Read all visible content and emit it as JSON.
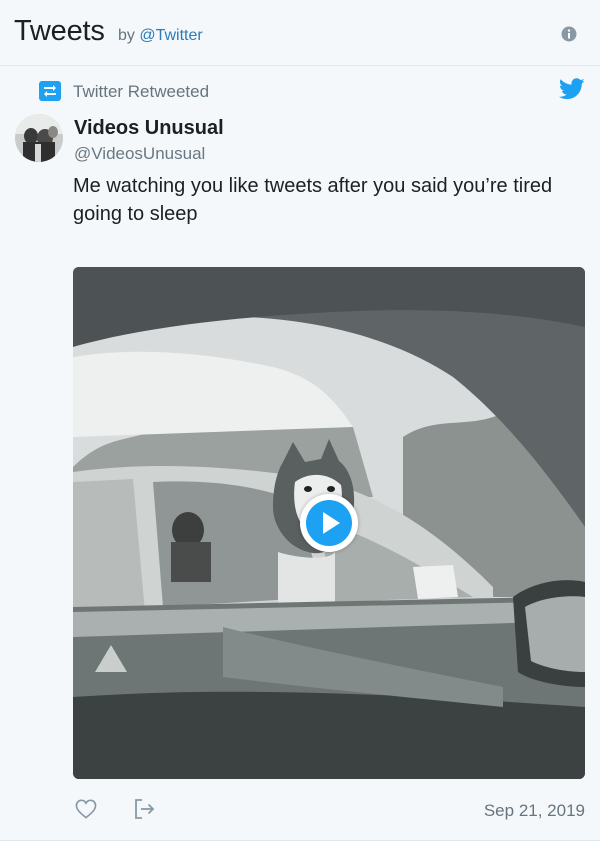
{
  "header": {
    "title": "Tweets",
    "by_label": "by",
    "handle": "@Twitter"
  },
  "retweet": {
    "label": "Twitter Retweeted"
  },
  "tweet": {
    "author_name": "Videos Unusual",
    "author_handle": "@VideosUnusual",
    "text": "Me watching you like tweets after you said you’re tired going to sleep",
    "date": "Sep 21, 2019"
  },
  "icons": {
    "info": "info-icon",
    "retweet": "retweet-icon",
    "bird": "twitter-bird-icon",
    "play": "play-icon",
    "like": "heart-icon",
    "share": "share-icon"
  },
  "colors": {
    "accent": "#1da1f2",
    "link": "#2b7bb9",
    "muted": "#66757f",
    "background": "#f5f8fa",
    "text": "#1c2022"
  }
}
